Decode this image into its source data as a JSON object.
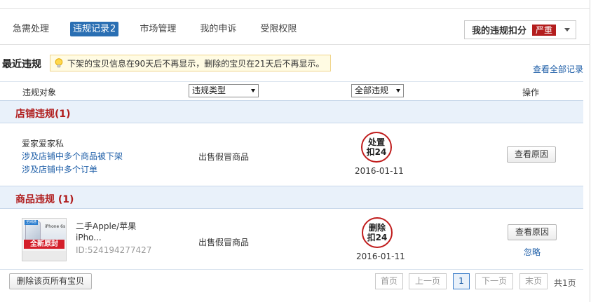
{
  "tabs": [
    {
      "label": "急需处理"
    },
    {
      "label": "违规记录",
      "count": "2"
    },
    {
      "label": "市场管理"
    },
    {
      "label": "我的申诉"
    },
    {
      "label": "受限权限"
    }
  ],
  "deduction": {
    "label": "我的违规扣分",
    "badge": "严重"
  },
  "recent": {
    "title": "最近违规",
    "tip": "下架的宝贝信息在90天后不再显示，删除的宝贝在21天后不再显示。",
    "view_all": "查看全部记录"
  },
  "table_header": {
    "object": "违规对象",
    "type_select": "违规类型",
    "scope_select": "全部违规",
    "operation": "操作"
  },
  "store_group": {
    "title": "店铺违规(1)",
    "row": {
      "store_name": "爱家爱家私",
      "links": [
        "涉及店铺中多个商品被下架",
        "涉及店铺中多个订单"
      ],
      "reason": "出售假冒商品",
      "stamp": {
        "action": "处置",
        "points": "扣24"
      },
      "date": "2016-01-11",
      "button": "查看原因"
    }
  },
  "product_group": {
    "title": "商品违规 (1)",
    "row": {
      "thumb": {
        "tag": "全网通",
        "model": "iPhone 6s",
        "banner": "全新原封"
      },
      "name_line1": "二手Apple/苹果",
      "name_line2": "iPho...",
      "item_id": "ID:524194277427",
      "reason": "出售假冒商品",
      "stamp": {
        "action": "删除",
        "points": "扣24"
      },
      "date": "2016-01-11",
      "button": "查看原因",
      "ignore": "忽略"
    }
  },
  "footer": {
    "delete_all": "删除该页所有宝贝",
    "pagination": {
      "first": "首页",
      "prev": "上一页",
      "current": "1",
      "next": "下一页",
      "last": "末页",
      "total": "共1页"
    }
  },
  "colors": {
    "accent": "#2a6fb3",
    "danger": "#b01c1c",
    "link": "#1f5fa8",
    "group_bg": "#e9f1fa"
  }
}
